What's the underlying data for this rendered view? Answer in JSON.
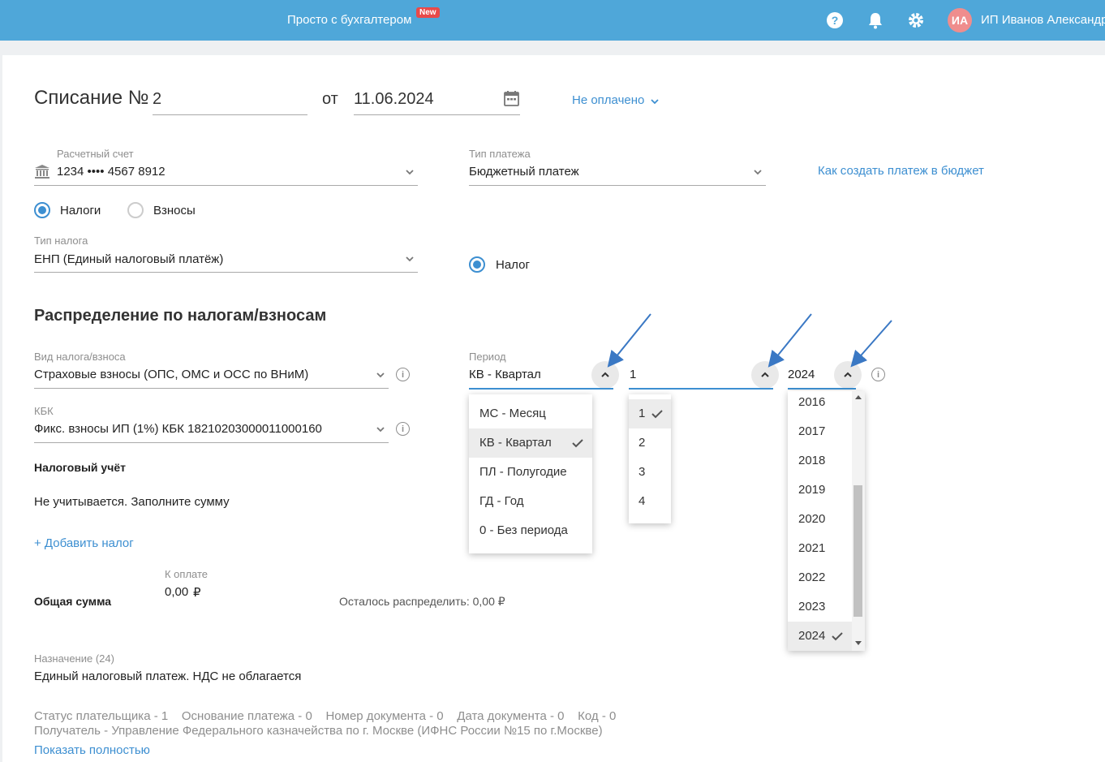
{
  "topbar": {
    "brand": "Просто с бухгалтером",
    "badge": "New",
    "avatar_initials": "ИА",
    "user_name": "ИП Иванов Александр"
  },
  "doc": {
    "title_prefix": "Списание №",
    "number": "2",
    "date_prefix": "от",
    "date": "11.06.2024",
    "status": "Не оплачено"
  },
  "account": {
    "label": "Расчетный счет",
    "value": "1234 •••• 4567 8912"
  },
  "payment_type": {
    "label": "Тип платежа",
    "value": "Бюджетный платеж"
  },
  "help_link": "Как создать платеж в бюджет",
  "radios": {
    "taxes": "Налоги",
    "contributions": "Взносы",
    "tax": "Налог"
  },
  "tax_type": {
    "label": "Тип налога",
    "value": "ЕНП (Единый налоговый платёж)"
  },
  "distribution": {
    "title": "Распределение по налогам/взносам",
    "kind_label": "Вид налога/взноса",
    "kind_value": "Страховые взносы (ОПС, ОМС и ОСС по ВНиМ)",
    "kbk_label": "КБК",
    "kbk_value": "Фикс. взносы ИП (1%) КБК 18210203000011000160",
    "period_label": "Период",
    "period_value": "КВ - Квартал",
    "quarter_value": "1",
    "year_value": "2024",
    "period_options": [
      "МС - Месяц",
      "КВ - Квартал",
      "ПЛ - Полугодие",
      "ГД - Год",
      "0 - Без периода"
    ],
    "quarter_options": [
      "1",
      "2",
      "3",
      "4"
    ],
    "year_options": [
      "2016",
      "2017",
      "2018",
      "2019",
      "2020",
      "2021",
      "2022",
      "2023",
      "2024"
    ]
  },
  "accounting": {
    "title": "Налоговый учёт",
    "text": "Не учитывается. Заполните сумму"
  },
  "add_tax_link": "+ Добавить налог",
  "totals": {
    "title": "Общая сумма",
    "pay_label": "К оплате",
    "pay_value": "0,00",
    "currency": "₽",
    "remaining": "Осталось распределить: 0,00 ₽"
  },
  "purpose": {
    "label": "Назначение (24)",
    "value": "Единый налоговый платеж. НДС не облагается"
  },
  "details": {
    "line1": "Статус плательщика - 1    Основание платежа - 0    Номер документа - 0    Дата документа - 0    Код - 0",
    "line2": "Получатель - Управление Федерального казначейства по г. Москве (ИФНС России №15 по г.Москве)",
    "show_all": "Показать полностью"
  },
  "colors": {
    "topbar": "#4fa7d9",
    "accent": "#3d8fd1",
    "badge": "#e94a4a",
    "avatar": "#ef8d8d"
  }
}
